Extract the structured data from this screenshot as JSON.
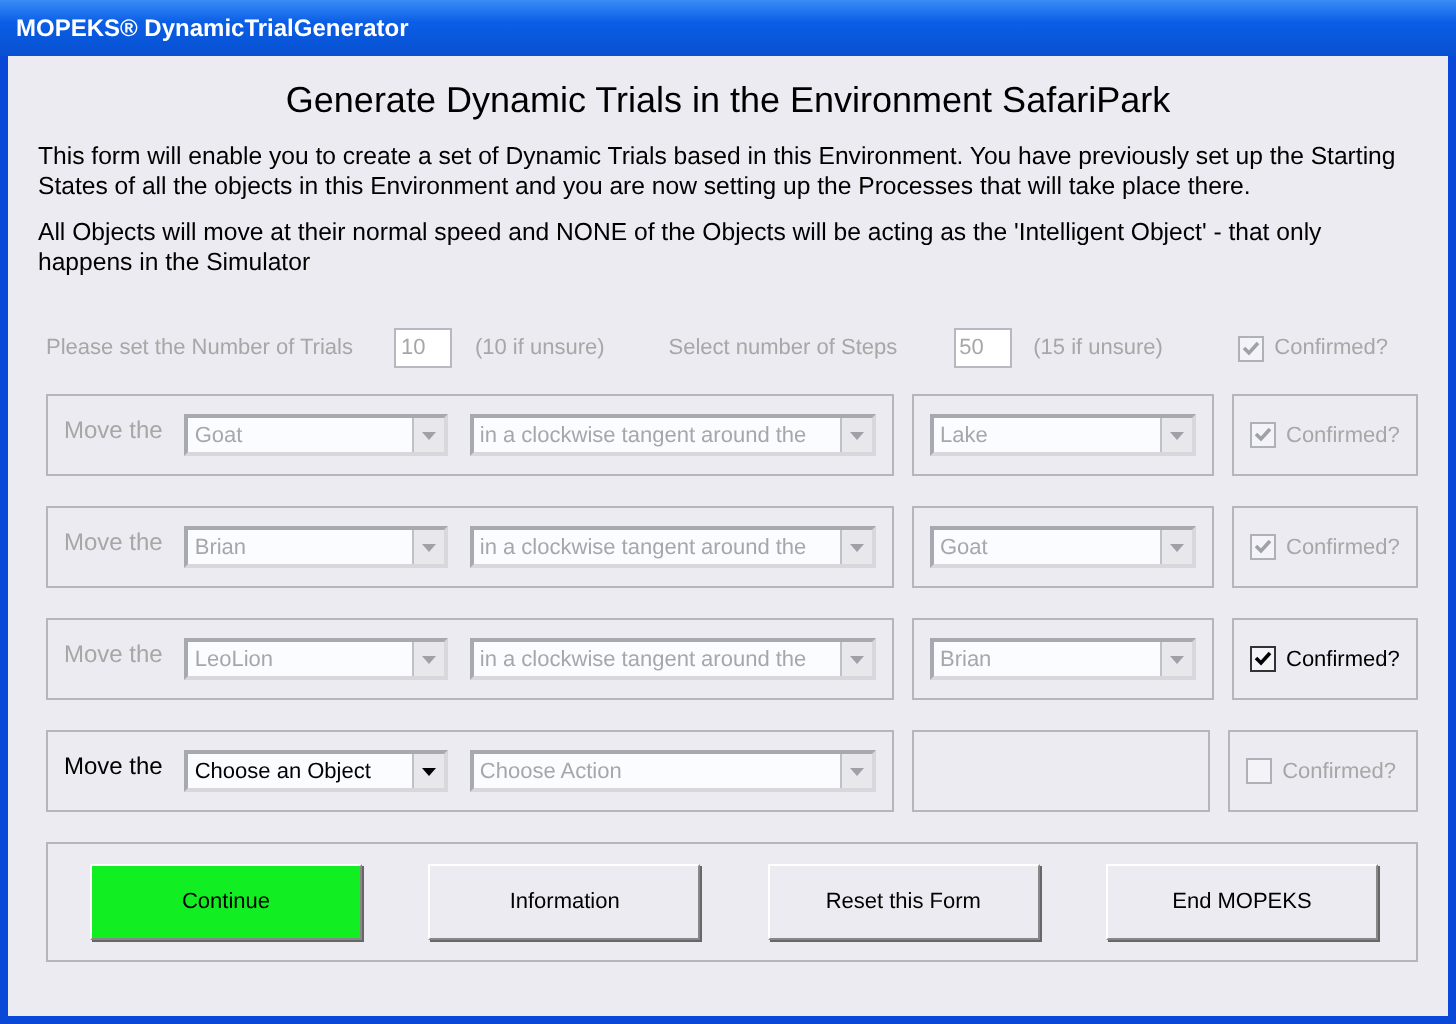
{
  "window": {
    "title": "MOPEKS® DynamicTrialGenerator"
  },
  "heading": "Generate Dynamic Trials in the Environment SafariPark",
  "paragraphs": [
    "This form will enable you to create a set of Dynamic Trials based in this Environment. You have previously set up the Starting States of all the objects in this Environment and you are now setting up the Processes that will take place there.",
    "All Objects will move at their normal speed and NONE of the Objects will be acting as the 'Intelligent Object' - that only happens in the Simulator"
  ],
  "settings": {
    "disabled": true,
    "trials_label": "Please set the Number of Trials",
    "trials_value": "10",
    "trials_hint": "(10 if unsure)",
    "steps_label": "Select number of Steps",
    "steps_value": "50",
    "steps_hint": "(15 if unsure)",
    "confirm": {
      "label": "Confirmed?",
      "checked": true,
      "disabled": true
    }
  },
  "moves": [
    {
      "label": "Move the",
      "disabled": true,
      "object": {
        "value": "Goat",
        "disabled": true
      },
      "action": {
        "value": "in a clockwise tangent around the",
        "disabled": true
      },
      "target": {
        "value": "Lake",
        "disabled": true
      },
      "confirm": {
        "label": "Confirmed?",
        "checked": true,
        "disabled": true
      }
    },
    {
      "label": "Move the",
      "disabled": true,
      "object": {
        "value": "Brian",
        "disabled": true
      },
      "action": {
        "value": "in a clockwise tangent around the",
        "disabled": true
      },
      "target": {
        "value": "Goat",
        "disabled": true
      },
      "confirm": {
        "label": "Confirmed?",
        "checked": true,
        "disabled": true
      }
    },
    {
      "label": "Move the",
      "disabled": true,
      "object": {
        "value": "LeoLion",
        "disabled": true
      },
      "action": {
        "value": "in a clockwise tangent around the",
        "disabled": true
      },
      "target": {
        "value": "Brian",
        "disabled": true
      },
      "confirm": {
        "label": "Confirmed?",
        "checked": true,
        "disabled": false
      }
    },
    {
      "label": "Move the",
      "disabled": false,
      "object": {
        "value": "Choose an Object",
        "disabled": false
      },
      "action": {
        "value": "Choose Action",
        "disabled": true
      },
      "confirm": {
        "label": "Confirmed?",
        "checked": false,
        "disabled": true
      }
    }
  ],
  "buttons": [
    {
      "label": "Continue",
      "kind": "primary"
    },
    {
      "label": "Information",
      "kind": "normal"
    },
    {
      "label": "Reset this Form",
      "kind": "normal"
    },
    {
      "label": "End MOPEKS",
      "kind": "normal"
    }
  ]
}
